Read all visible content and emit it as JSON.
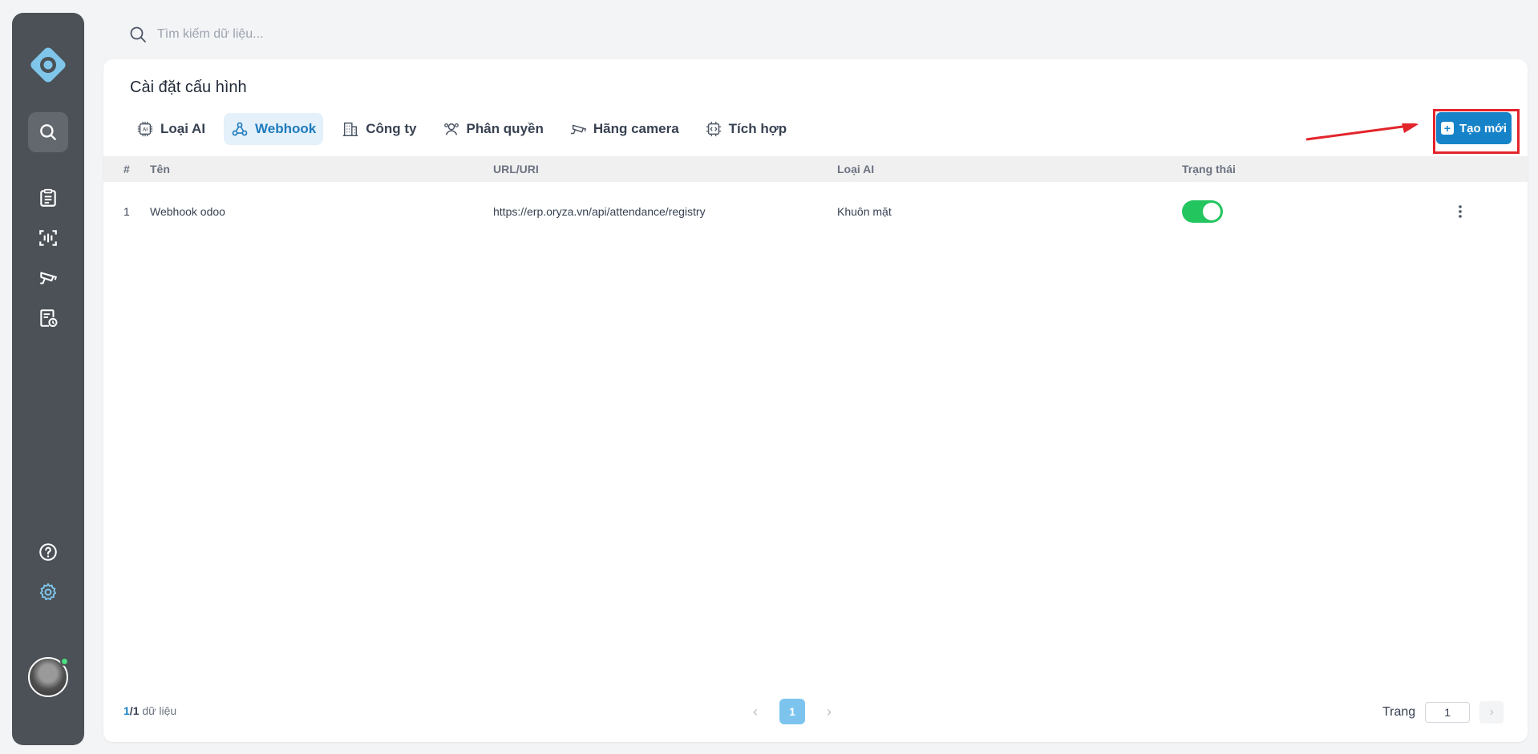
{
  "search": {
    "placeholder": "Tìm kiếm dữ liệu..."
  },
  "page_title": "Cài đặt cấu hình",
  "tabs": [
    {
      "label": "Loại AI",
      "icon": "ai-chip-icon",
      "active": false
    },
    {
      "label": "Webhook",
      "icon": "webhook-icon",
      "active": true
    },
    {
      "label": "Công ty",
      "icon": "building-icon",
      "active": false
    },
    {
      "label": "Phân quyền",
      "icon": "user-group-icon",
      "active": false
    },
    {
      "label": "Hãng camera",
      "icon": "camera-icon",
      "active": false
    },
    {
      "label": "Tích hợp",
      "icon": "integration-chip-icon",
      "active": false
    }
  ],
  "create_button": {
    "label": "Tạo mới"
  },
  "table": {
    "columns": [
      "#",
      "Tên",
      "URL/URI",
      "Loại AI",
      "Trạng thái"
    ],
    "rows": [
      {
        "num": "1",
        "name": "Webhook odoo",
        "url": "https://erp.oryza.vn/api/attendance/registry",
        "ai_type": "Khuôn mặt",
        "status": "on"
      }
    ]
  },
  "footer": {
    "current": "1",
    "total": "1",
    "count_suffix": "dữ liệu",
    "page": "1",
    "goto_label": "Trang",
    "goto_value": "1"
  },
  "colors": {
    "accent": "#1683c9",
    "sidebar": "#4b5157",
    "toggle_on": "#22c55e",
    "highlight": "#e3242b"
  }
}
